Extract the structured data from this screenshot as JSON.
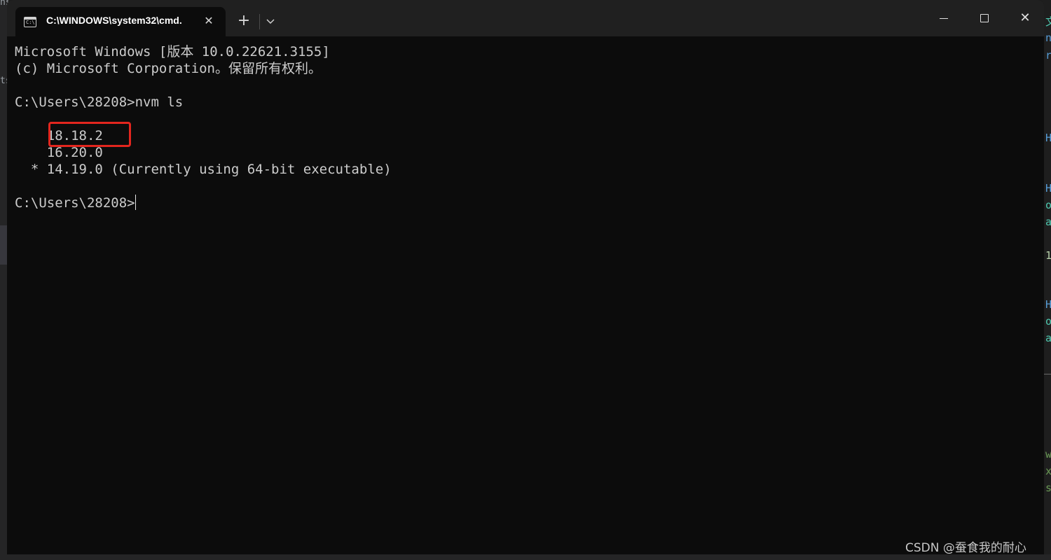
{
  "window": {
    "tab_title": "C:\\WINDOWS\\system32\\cmd.",
    "tab_close_glyph": "✕",
    "new_tab_glyph": "+",
    "dropdown_glyph": "⌄",
    "close_glyph": "✕",
    "icons": {
      "tab": "terminal-icon",
      "close_tab": "close-icon",
      "new_tab": "plus-icon",
      "dropdown": "chevron-down-icon",
      "minimize": "minimize-icon",
      "maximize": "maximize-icon",
      "close": "close-icon"
    }
  },
  "console": {
    "lines": [
      "Microsoft Windows [版本 10.0.22621.3155]",
      "(c) Microsoft Corporation。保留所有权利。",
      "",
      "C:\\Users\\28208>nvm ls",
      "",
      "    18.18.2",
      "    16.20.0",
      "  * 14.19.0 (Currently using 64-bit executable)",
      "",
      "C:\\Users\\28208>"
    ],
    "highlighted_version": "18.18.2"
  },
  "colors": {
    "console_bg": "#0c0c0c",
    "console_text": "#cccccc",
    "titlebar_bg": "#202020",
    "highlight_border": "#e3261e"
  },
  "watermark": "CSDN @蚕食我的耐心"
}
